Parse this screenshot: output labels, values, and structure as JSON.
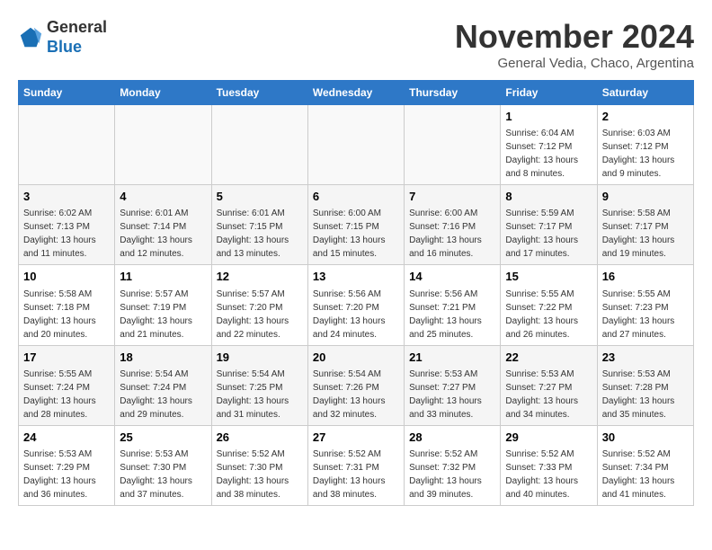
{
  "logo": {
    "line1": "General",
    "line2": "Blue"
  },
  "title": "November 2024",
  "subtitle": "General Vedia, Chaco, Argentina",
  "weekdays": [
    "Sunday",
    "Monday",
    "Tuesday",
    "Wednesday",
    "Thursday",
    "Friday",
    "Saturday"
  ],
  "weeks": [
    [
      {
        "day": "",
        "info": ""
      },
      {
        "day": "",
        "info": ""
      },
      {
        "day": "",
        "info": ""
      },
      {
        "day": "",
        "info": ""
      },
      {
        "day": "",
        "info": ""
      },
      {
        "day": "1",
        "info": "Sunrise: 6:04 AM\nSunset: 7:12 PM\nDaylight: 13 hours\nand 8 minutes."
      },
      {
        "day": "2",
        "info": "Sunrise: 6:03 AM\nSunset: 7:12 PM\nDaylight: 13 hours\nand 9 minutes."
      }
    ],
    [
      {
        "day": "3",
        "info": "Sunrise: 6:02 AM\nSunset: 7:13 PM\nDaylight: 13 hours\nand 11 minutes."
      },
      {
        "day": "4",
        "info": "Sunrise: 6:01 AM\nSunset: 7:14 PM\nDaylight: 13 hours\nand 12 minutes."
      },
      {
        "day": "5",
        "info": "Sunrise: 6:01 AM\nSunset: 7:15 PM\nDaylight: 13 hours\nand 13 minutes."
      },
      {
        "day": "6",
        "info": "Sunrise: 6:00 AM\nSunset: 7:15 PM\nDaylight: 13 hours\nand 15 minutes."
      },
      {
        "day": "7",
        "info": "Sunrise: 6:00 AM\nSunset: 7:16 PM\nDaylight: 13 hours\nand 16 minutes."
      },
      {
        "day": "8",
        "info": "Sunrise: 5:59 AM\nSunset: 7:17 PM\nDaylight: 13 hours\nand 17 minutes."
      },
      {
        "day": "9",
        "info": "Sunrise: 5:58 AM\nSunset: 7:17 PM\nDaylight: 13 hours\nand 19 minutes."
      }
    ],
    [
      {
        "day": "10",
        "info": "Sunrise: 5:58 AM\nSunset: 7:18 PM\nDaylight: 13 hours\nand 20 minutes."
      },
      {
        "day": "11",
        "info": "Sunrise: 5:57 AM\nSunset: 7:19 PM\nDaylight: 13 hours\nand 21 minutes."
      },
      {
        "day": "12",
        "info": "Sunrise: 5:57 AM\nSunset: 7:20 PM\nDaylight: 13 hours\nand 22 minutes."
      },
      {
        "day": "13",
        "info": "Sunrise: 5:56 AM\nSunset: 7:20 PM\nDaylight: 13 hours\nand 24 minutes."
      },
      {
        "day": "14",
        "info": "Sunrise: 5:56 AM\nSunset: 7:21 PM\nDaylight: 13 hours\nand 25 minutes."
      },
      {
        "day": "15",
        "info": "Sunrise: 5:55 AM\nSunset: 7:22 PM\nDaylight: 13 hours\nand 26 minutes."
      },
      {
        "day": "16",
        "info": "Sunrise: 5:55 AM\nSunset: 7:23 PM\nDaylight: 13 hours\nand 27 minutes."
      }
    ],
    [
      {
        "day": "17",
        "info": "Sunrise: 5:55 AM\nSunset: 7:24 PM\nDaylight: 13 hours\nand 28 minutes."
      },
      {
        "day": "18",
        "info": "Sunrise: 5:54 AM\nSunset: 7:24 PM\nDaylight: 13 hours\nand 29 minutes."
      },
      {
        "day": "19",
        "info": "Sunrise: 5:54 AM\nSunset: 7:25 PM\nDaylight: 13 hours\nand 31 minutes."
      },
      {
        "day": "20",
        "info": "Sunrise: 5:54 AM\nSunset: 7:26 PM\nDaylight: 13 hours\nand 32 minutes."
      },
      {
        "day": "21",
        "info": "Sunrise: 5:53 AM\nSunset: 7:27 PM\nDaylight: 13 hours\nand 33 minutes."
      },
      {
        "day": "22",
        "info": "Sunrise: 5:53 AM\nSunset: 7:27 PM\nDaylight: 13 hours\nand 34 minutes."
      },
      {
        "day": "23",
        "info": "Sunrise: 5:53 AM\nSunset: 7:28 PM\nDaylight: 13 hours\nand 35 minutes."
      }
    ],
    [
      {
        "day": "24",
        "info": "Sunrise: 5:53 AM\nSunset: 7:29 PM\nDaylight: 13 hours\nand 36 minutes."
      },
      {
        "day": "25",
        "info": "Sunrise: 5:53 AM\nSunset: 7:30 PM\nDaylight: 13 hours\nand 37 minutes."
      },
      {
        "day": "26",
        "info": "Sunrise: 5:52 AM\nSunset: 7:30 PM\nDaylight: 13 hours\nand 38 minutes."
      },
      {
        "day": "27",
        "info": "Sunrise: 5:52 AM\nSunset: 7:31 PM\nDaylight: 13 hours\nand 38 minutes."
      },
      {
        "day": "28",
        "info": "Sunrise: 5:52 AM\nSunset: 7:32 PM\nDaylight: 13 hours\nand 39 minutes."
      },
      {
        "day": "29",
        "info": "Sunrise: 5:52 AM\nSunset: 7:33 PM\nDaylight: 13 hours\nand 40 minutes."
      },
      {
        "day": "30",
        "info": "Sunrise: 5:52 AM\nSunset: 7:34 PM\nDaylight: 13 hours\nand 41 minutes."
      }
    ]
  ]
}
